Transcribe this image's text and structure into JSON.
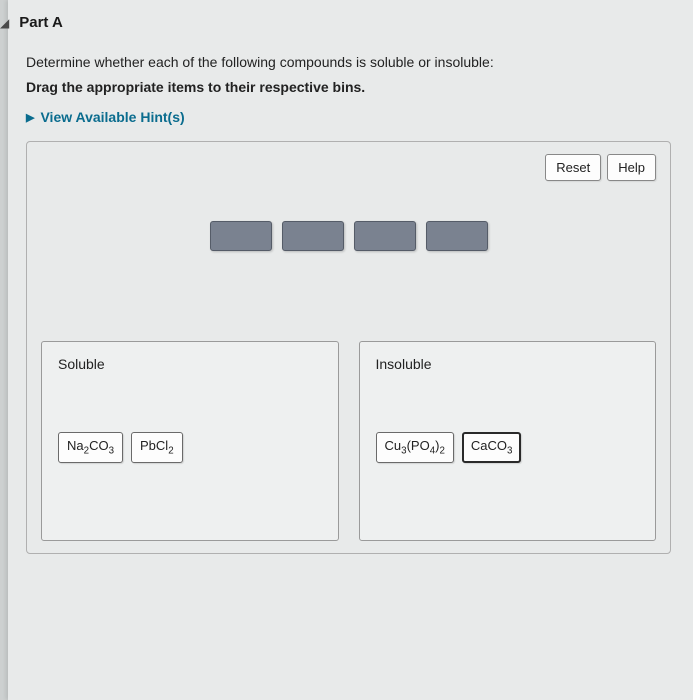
{
  "part": {
    "label": "Part A"
  },
  "instructions": "Determine whether each of the following compounds is soluble or insoluble:",
  "drag_instructions": "Drag the appropriate items to their respective bins.",
  "hints": {
    "label": "View Available Hint(s)"
  },
  "toolbar": {
    "reset_label": "Reset",
    "help_label": "Help"
  },
  "bins": {
    "soluble": {
      "label": "Soluble",
      "items": [
        {
          "formula": "Na2CO3"
        },
        {
          "formula": "PbCl2"
        }
      ]
    },
    "insoluble": {
      "label": "Insoluble",
      "items": [
        {
          "formula": "Cu3(PO4)2"
        },
        {
          "formula": "CaCO3",
          "selected": true
        }
      ]
    }
  },
  "staging_placeholders": 4
}
